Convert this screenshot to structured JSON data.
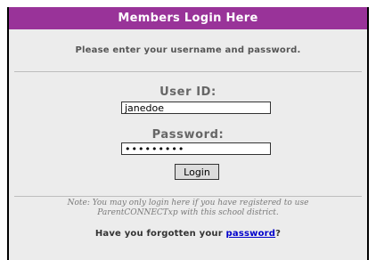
{
  "header": {
    "title": "Members Login Here"
  },
  "instructions": {
    "text": "Please enter your username and password."
  },
  "form": {
    "user_label": "User ID:",
    "user_value": "janedoe",
    "password_label": "Password:",
    "password_value": "•••••••••",
    "login_button": "Login"
  },
  "note": {
    "line1": "Note: You may only login here if you have registered to use",
    "line2": "ParentCONNECTxp with this school district."
  },
  "forgot": {
    "prefix": "Have you forgotten your ",
    "link_text": "password",
    "suffix": "?"
  },
  "colors": {
    "header_bg": "#993399",
    "panel_bg": "#ececec",
    "link": "#0000cc"
  }
}
